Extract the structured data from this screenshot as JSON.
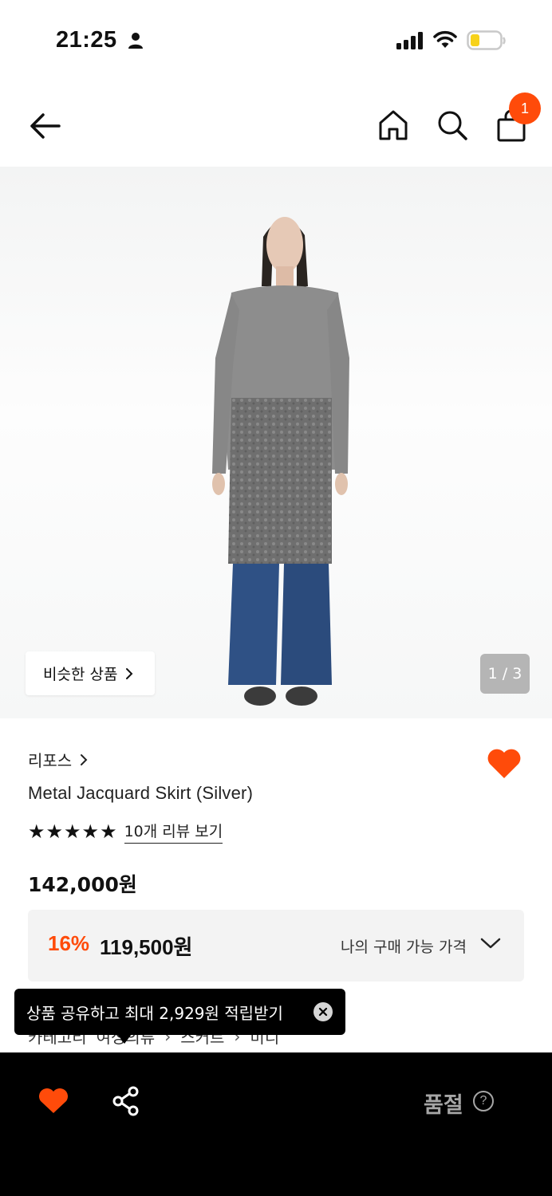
{
  "status_bar": {
    "time": "21:25",
    "icons": [
      "person-icon",
      "cellular-signal-icon",
      "wifi-icon",
      "battery-icon"
    ]
  },
  "nav": {
    "cart_count": "1",
    "icons": [
      "back-arrow-icon",
      "home-icon",
      "search-icon",
      "shopping-bag-icon"
    ]
  },
  "gallery": {
    "similar_label": "비슷한 상품",
    "page_indicator": "1 / 3"
  },
  "product": {
    "brand": "리포스",
    "name": "Metal Jacquard Skirt (Silver)",
    "rating_stars": 5,
    "review_link": "10개 리뷰 보기",
    "list_price": "142,000원",
    "discount_rate": "16%",
    "sale_price": "119,500원",
    "my_price_label": "나의 구매 가능 가격"
  },
  "category": {
    "label": "카테고리",
    "path": [
      "여성의류",
      "스커트",
      "미디"
    ]
  },
  "tooltip": {
    "text": "상품 공유하고 최대 2,929원 적립받기"
  },
  "bottom_bar": {
    "soldout_label": "품절",
    "help_glyph": "?"
  },
  "colors": {
    "accent": "#ff4b0a",
    "bottom_bar_bg": "#000000",
    "price_box_bg": "#f3f3f3",
    "soldout_text": "#a6a6a6"
  }
}
